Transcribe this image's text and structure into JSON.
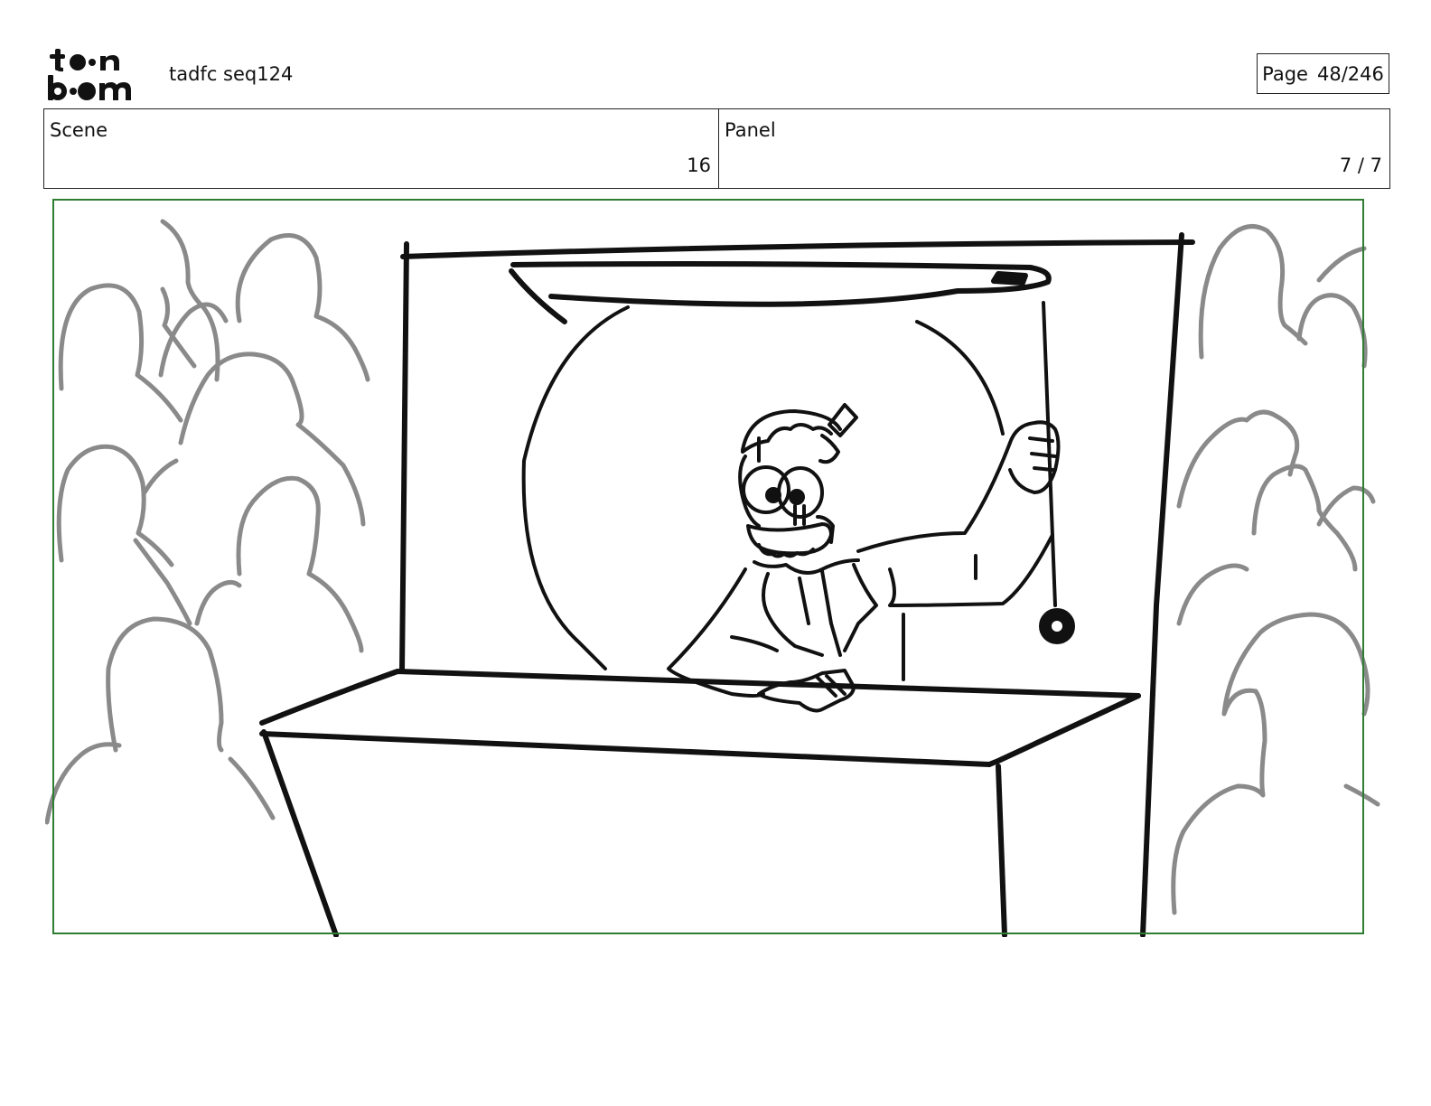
{
  "header": {
    "logo": {
      "text": "toon boom",
      "icon": "toon-boom-logo"
    },
    "project_title": "tadfc seq124",
    "page": {
      "label": "Page",
      "value": "48/246"
    }
  },
  "info": {
    "scene": {
      "label": "Scene",
      "value": "16"
    },
    "panel": {
      "label": "Panel",
      "value": "7 / 7"
    }
  },
  "colors": {
    "frame_border": "#2e7d32",
    "crowd_stroke": "#8a8a8a",
    "ink": "#111111"
  }
}
